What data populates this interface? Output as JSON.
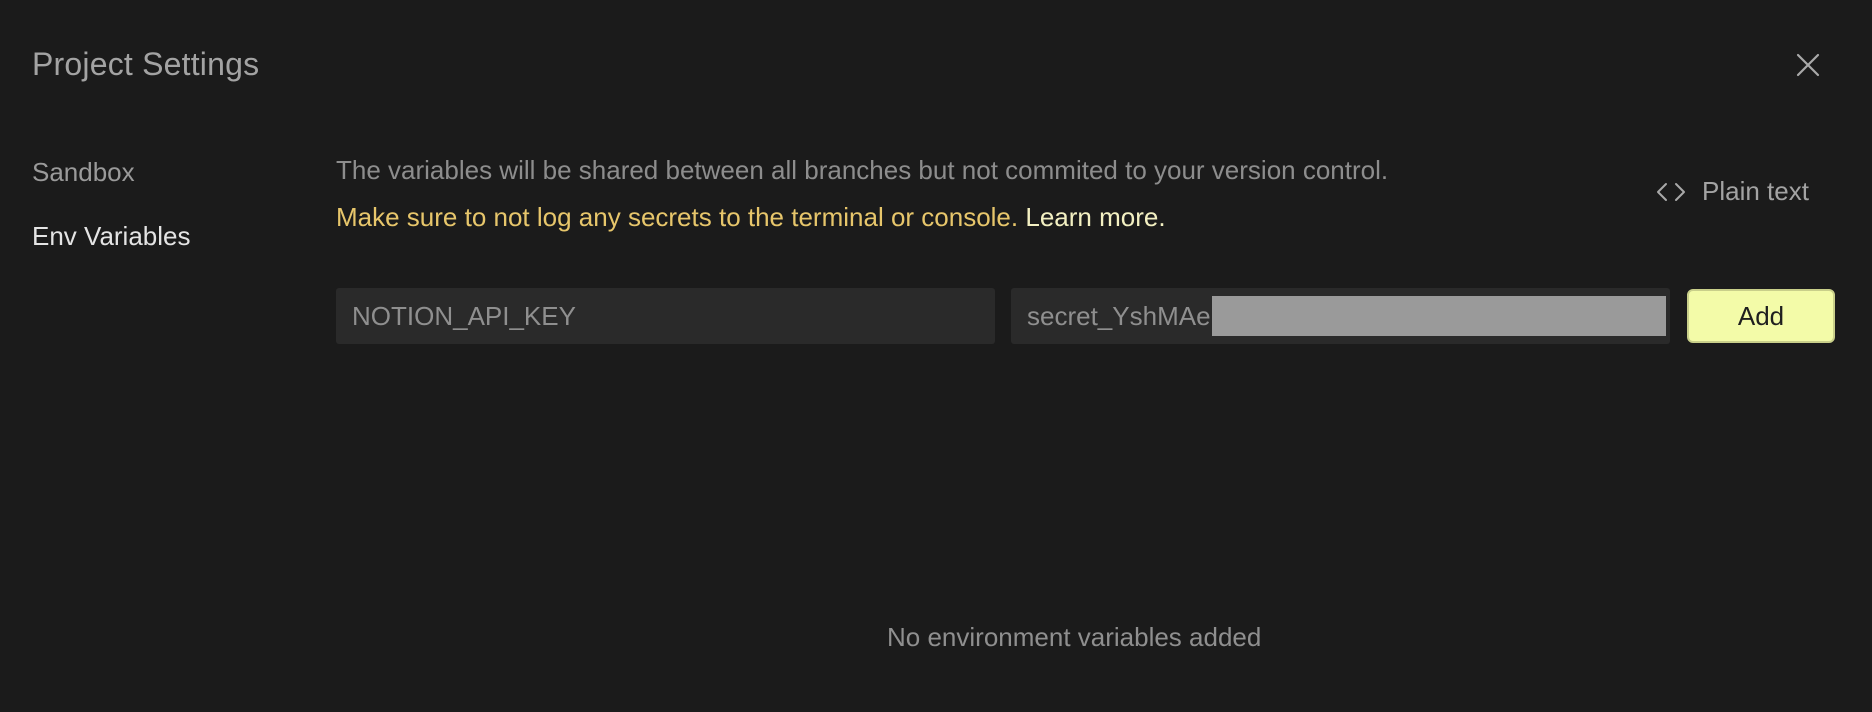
{
  "modal": {
    "title": "Project Settings",
    "close_icon": "close-icon"
  },
  "sidebar": {
    "items": [
      {
        "label": "Sandbox",
        "active": false
      },
      {
        "label": "Env Variables",
        "active": true
      }
    ]
  },
  "env": {
    "description": "The variables will be shared between all branches but not commited to your version control.",
    "warning": "Make sure to not log any secrets to the terminal or console.",
    "learn_more": "Learn more.",
    "plain_text_toggle": {
      "label": "Plain text",
      "icon": "code-brackets-icon"
    },
    "key_input": {
      "value": "NOTION_API_KEY"
    },
    "value_input": {
      "value": "secret_YshMAe"
    },
    "add_button": "Add",
    "empty_state": "No environment variables added"
  },
  "colors": {
    "background": "#1b1b1b",
    "warning": "#e7c66b",
    "accent_button": "#f3fba8",
    "input_bg": "#2a2a2a"
  }
}
